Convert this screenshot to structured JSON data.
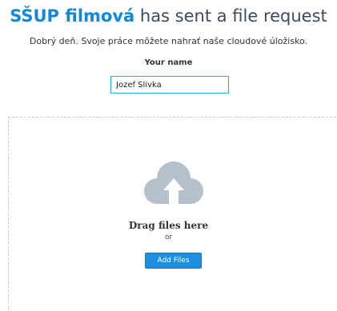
{
  "header": {
    "sender": "SŠUP filmová",
    "title_rest": " has sent a file request"
  },
  "subtitle": "Dobrý deň. Svoje práce môžete nahrať naše cloudové úložisko.",
  "name_field": {
    "label": "Your name",
    "value": "Jozef Slivka"
  },
  "dropzone": {
    "icon": "cloud-upload-icon",
    "drag_text": "Drag files here",
    "or_text": "or",
    "add_button": "Add Files"
  },
  "colors": {
    "accent": "#1686d8",
    "title": "#3d4b5c",
    "cloud": "#b5c0cb",
    "button": "#1e8fe0",
    "input_border": "#3aa3e3",
    "dropzone_border": "#c5c9cf"
  }
}
